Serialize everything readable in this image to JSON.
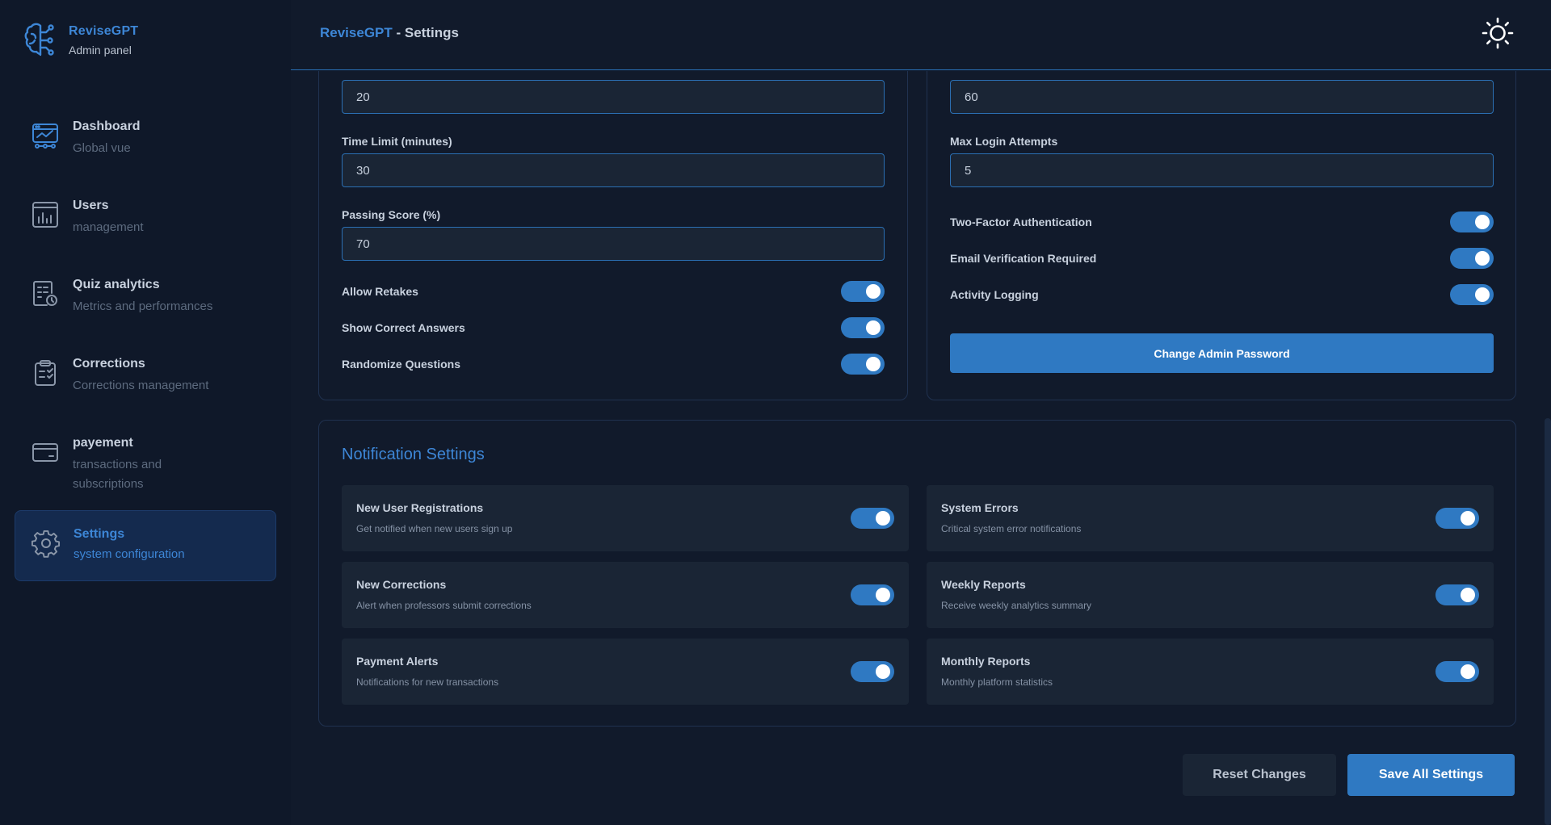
{
  "brand": {
    "name": "ReviseGPT",
    "subtitle": "Admin panel"
  },
  "sidebar": {
    "items": [
      {
        "title": "Dashboard",
        "subtitle": "Global vue",
        "icon": "dashboard-icon"
      },
      {
        "title": "Users",
        "subtitle": "management",
        "icon": "users-chart-icon"
      },
      {
        "title": "Quiz analytics",
        "subtitle": "Metrics and performances",
        "icon": "quiz-analytics-icon"
      },
      {
        "title": "Corrections",
        "subtitle": "Corrections management",
        "icon": "clipboard-check-icon"
      },
      {
        "title": "payement",
        "subtitle": "transactions and subscriptions",
        "icon": "credit-card-icon"
      },
      {
        "title": "Settings",
        "subtitle": "system configuration",
        "icon": "gear-icon",
        "active": true
      }
    ]
  },
  "header": {
    "app": "ReviseGPT",
    "separator": " - ",
    "page": "Settings",
    "theme_icon": "sun-icon"
  },
  "quiz": {
    "questions_value": "20",
    "time_limit_label": "Time Limit (minutes)",
    "time_limit_value": "30",
    "passing_score_label": "Passing Score (%)",
    "passing_score_value": "70",
    "toggles": [
      {
        "label": "Allow Retakes",
        "on": true
      },
      {
        "label": "Show Correct Answers",
        "on": true
      },
      {
        "label": "Randomize Questions",
        "on": true
      }
    ]
  },
  "security": {
    "session_value": "60",
    "max_login_label": "Max Login Attempts",
    "max_login_value": "5",
    "toggles": [
      {
        "label": "Two-Factor Authentication",
        "on": true
      },
      {
        "label": "Email Verification Required",
        "on": true
      },
      {
        "label": "Activity Logging",
        "on": true
      }
    ],
    "change_password_label": "Change Admin Password"
  },
  "notifications": {
    "title": "Notification Settings",
    "items": [
      {
        "title": "New User Registrations",
        "desc": "Get notified when new users sign up",
        "on": true
      },
      {
        "title": "System Errors",
        "desc": "Critical system error notifications",
        "on": true
      },
      {
        "title": "New Corrections",
        "desc": "Alert when professors submit corrections",
        "on": true
      },
      {
        "title": "Weekly Reports",
        "desc": "Receive weekly analytics summary",
        "on": true
      },
      {
        "title": "Payment Alerts",
        "desc": "Notifications for new transactions",
        "on": true
      },
      {
        "title": "Monthly Reports",
        "desc": "Monthly platform statistics",
        "on": true
      }
    ]
  },
  "actions": {
    "reset_label": "Reset Changes",
    "save_label": "Save All Settings"
  },
  "colors": {
    "accent": "#3d86d6",
    "toggle_on": "#2f79c2",
    "background": "#111a2b",
    "card": "#1a2535"
  }
}
